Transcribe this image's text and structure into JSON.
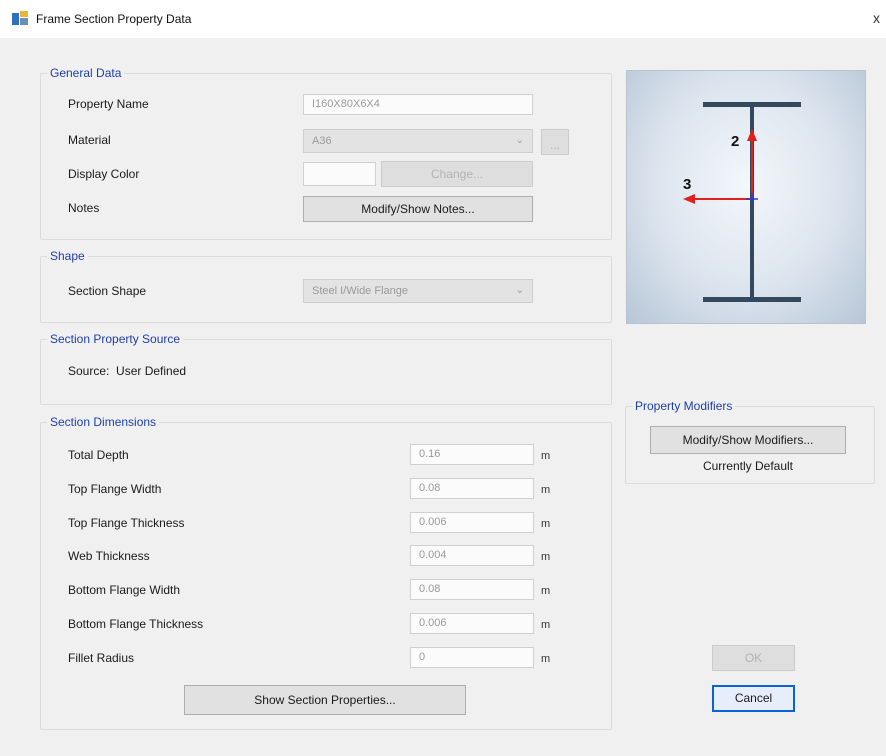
{
  "window": {
    "title": "Frame Section Property Data",
    "close_glyph": "x"
  },
  "general_data": {
    "title": "General Data",
    "property_name_label": "Property Name",
    "property_name_value": "I160X80X6X4",
    "material_label": "Material",
    "material_value": "A36",
    "material_button": "...",
    "display_color_label": "Display Color",
    "change_button": "Change...",
    "notes_label": "Notes",
    "notes_button": "Modify/Show Notes..."
  },
  "shape": {
    "title": "Shape",
    "section_shape_label": "Section Shape",
    "section_shape_value": "Steel I/Wide Flange"
  },
  "source": {
    "title": "Section Property Source",
    "text": "Source:  User Defined"
  },
  "dimensions": {
    "title": "Section Dimensions",
    "unit": "m",
    "rows": [
      {
        "label": "Total Depth",
        "value": "0.16"
      },
      {
        "label": "Top Flange Width",
        "value": "0.08"
      },
      {
        "label": "Top Flange Thickness",
        "value": "0.006"
      },
      {
        "label": "Web Thickness",
        "value": "0.004"
      },
      {
        "label": "Bottom Flange Width",
        "value": "0.08"
      },
      {
        "label": "Bottom Flange Thickness",
        "value": "0.006"
      },
      {
        "label": "Fillet Radius",
        "value": "0"
      }
    ],
    "show_properties_button": "Show Section Properties..."
  },
  "preview": {
    "axis_2_label": "2",
    "axis_3_label": "3",
    "axis_color": "#e0201a",
    "section_color": "#34495e",
    "centroid_color": "#1f3fd0"
  },
  "modifiers": {
    "title": "Property Modifiers",
    "button": "Modify/Show Modifiers...",
    "status": "Currently Default"
  },
  "actions": {
    "ok": "OK",
    "cancel": "Cancel"
  }
}
